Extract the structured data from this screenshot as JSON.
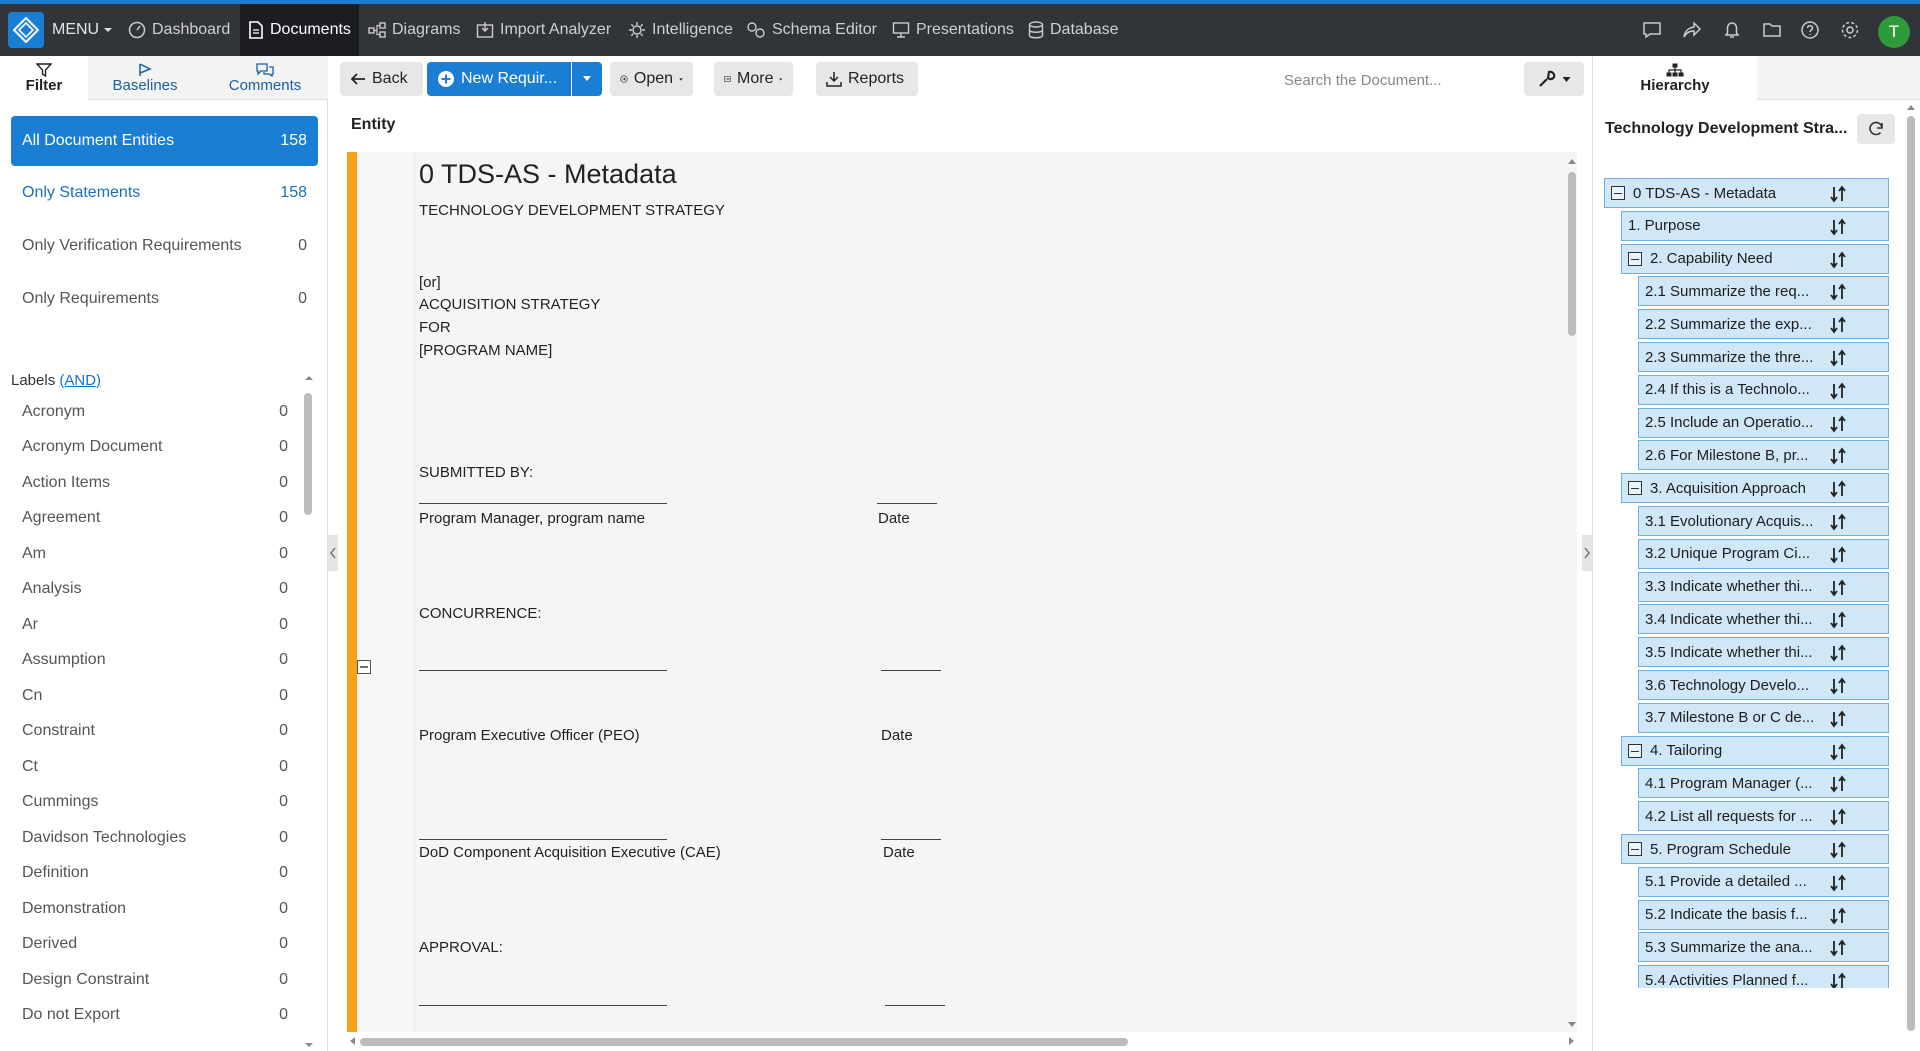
{
  "topnav": {
    "menu_label": "MENU",
    "items": [
      {
        "label": "Dashboard",
        "icon": "dashboard-icon"
      },
      {
        "label": "Documents",
        "icon": "document-icon",
        "active": true
      },
      {
        "label": "Diagrams",
        "icon": "diagram-icon"
      },
      {
        "label": "Import Analyzer",
        "icon": "import-icon"
      },
      {
        "label": "Intelligence",
        "icon": "intelligence-icon"
      },
      {
        "label": "Schema Editor",
        "icon": "schema-icon"
      },
      {
        "label": "Presentations",
        "icon": "presentation-icon"
      },
      {
        "label": "Database",
        "icon": "database-icon"
      }
    ],
    "avatar_initial": "T",
    "colors": {
      "bar": "#313438",
      "accent": "#1a7fd4",
      "avatar": "#2f9a3a"
    }
  },
  "left_panel": {
    "tabs": [
      {
        "label": "Filter",
        "icon": "filter-icon"
      },
      {
        "label": "Baselines",
        "icon": "baseline-flag-icon"
      },
      {
        "label": "Comments",
        "icon": "comments-icon"
      }
    ],
    "quick_filters": [
      {
        "label": "All Document Entities",
        "count": "158"
      },
      {
        "label": "Only Statements",
        "count": "158"
      },
      {
        "label": "Only Verification Requirements",
        "count": "0"
      },
      {
        "label": "Only Requirements",
        "count": "0"
      }
    ],
    "labels_heading": "Labels",
    "labels_mode": "(AND)",
    "labels": [
      {
        "name": "Acronym",
        "count": "0"
      },
      {
        "name": "Acronym Document",
        "count": "0"
      },
      {
        "name": "Action Items",
        "count": "0"
      },
      {
        "name": "Agreement",
        "count": "0"
      },
      {
        "name": "Am",
        "count": "0"
      },
      {
        "name": "Analysis",
        "count": "0"
      },
      {
        "name": "Ar",
        "count": "0"
      },
      {
        "name": "Assumption",
        "count": "0"
      },
      {
        "name": "Cn",
        "count": "0"
      },
      {
        "name": "Constraint",
        "count": "0"
      },
      {
        "name": "Ct",
        "count": "0"
      },
      {
        "name": "Cummings",
        "count": "0"
      },
      {
        "name": "Davidson Technologies",
        "count": "0"
      },
      {
        "name": "Definition",
        "count": "0"
      },
      {
        "name": "Demonstration",
        "count": "0"
      },
      {
        "name": "Derived",
        "count": "0"
      },
      {
        "name": "Design Constraint",
        "count": "0"
      },
      {
        "name": "Do not Export",
        "count": "0"
      }
    ]
  },
  "toolbar": {
    "back_label": "Back",
    "new_label": "New Requir...",
    "open_label": "Open",
    "more_label": "More",
    "reports_label": "Reports",
    "search_placeholder": "Search the Document..."
  },
  "document": {
    "entity_header": "Entity",
    "title": "0 TDS-AS - Metadata",
    "lines": {
      "strategy": "TECHNOLOGY DEVELOPMENT STRATEGY",
      "or": "[or]",
      "acq": "ACQUISITION STRATEGY",
      "for": "FOR",
      "program": "[PROGRAM NAME]",
      "submitted": "SUBMITTED BY:",
      "pm": "Program Manager, program name",
      "date1": "Date",
      "concurrence": "CONCURRENCE:",
      "peo": "Program Executive Officer (PEO)",
      "date2": "Date",
      "cae": "DoD Component Acquisition Executive (CAE)",
      "date3": "Date",
      "approval": "APPROVAL:"
    },
    "accent_color": "#f2a416"
  },
  "right_panel": {
    "tab_label": "Hierarchy",
    "title": "Technology Development Stra...",
    "tree": [
      {
        "label": "0 TDS-AS - Metadata",
        "level": 0,
        "toggle": true
      },
      {
        "label": "1. Purpose",
        "level": 1,
        "toggle": false
      },
      {
        "label": "2. Capability Need",
        "level": 1,
        "toggle": true
      },
      {
        "label": "2.1 Summarize the req...",
        "level": 2,
        "toggle": false
      },
      {
        "label": "2.2 Summarize the exp...",
        "level": 2,
        "toggle": false
      },
      {
        "label": "2.3 Summarize the thre...",
        "level": 2,
        "toggle": false
      },
      {
        "label": "2.4 If this is a Technolo...",
        "level": 2,
        "toggle": false
      },
      {
        "label": "2.5 Include an Operatio...",
        "level": 2,
        "toggle": false
      },
      {
        "label": "2.6 For Milestone B, pr...",
        "level": 2,
        "toggle": false
      },
      {
        "label": "3. Acquisition Approach",
        "level": 1,
        "toggle": true
      },
      {
        "label": "3.1 Evolutionary Acquis...",
        "level": 2,
        "toggle": false
      },
      {
        "label": "3.2 Unique Program Ci...",
        "level": 2,
        "toggle": false
      },
      {
        "label": "3.3 Indicate whether thi...",
        "level": 2,
        "toggle": false
      },
      {
        "label": "3.4 Indicate whether thi...",
        "level": 2,
        "toggle": false
      },
      {
        "label": "3.5 Indicate whether thi...",
        "level": 2,
        "toggle": false
      },
      {
        "label": "3.6 Technology Develo...",
        "level": 2,
        "toggle": false
      },
      {
        "label": "3.7 Milestone B or C de...",
        "level": 2,
        "toggle": false
      },
      {
        "label": "4. Tailoring",
        "level": 1,
        "toggle": true
      },
      {
        "label": "4.1 Program Manager (...",
        "level": 2,
        "toggle": false
      },
      {
        "label": "4.2 List all requests for ...",
        "level": 2,
        "toggle": false
      },
      {
        "label": "5. Program Schedule",
        "level": 1,
        "toggle": true
      },
      {
        "label": "5.1 Provide a detailed ...",
        "level": 2,
        "toggle": false
      },
      {
        "label": "5.2 Indicate the basis f...",
        "level": 2,
        "toggle": false
      },
      {
        "label": "5.3 Summarize the ana...",
        "level": 2,
        "toggle": false
      },
      {
        "label": "5.4 Activities Planned f...",
        "level": 2,
        "toggle": false
      }
    ],
    "node_color": "#cfe7f7"
  }
}
